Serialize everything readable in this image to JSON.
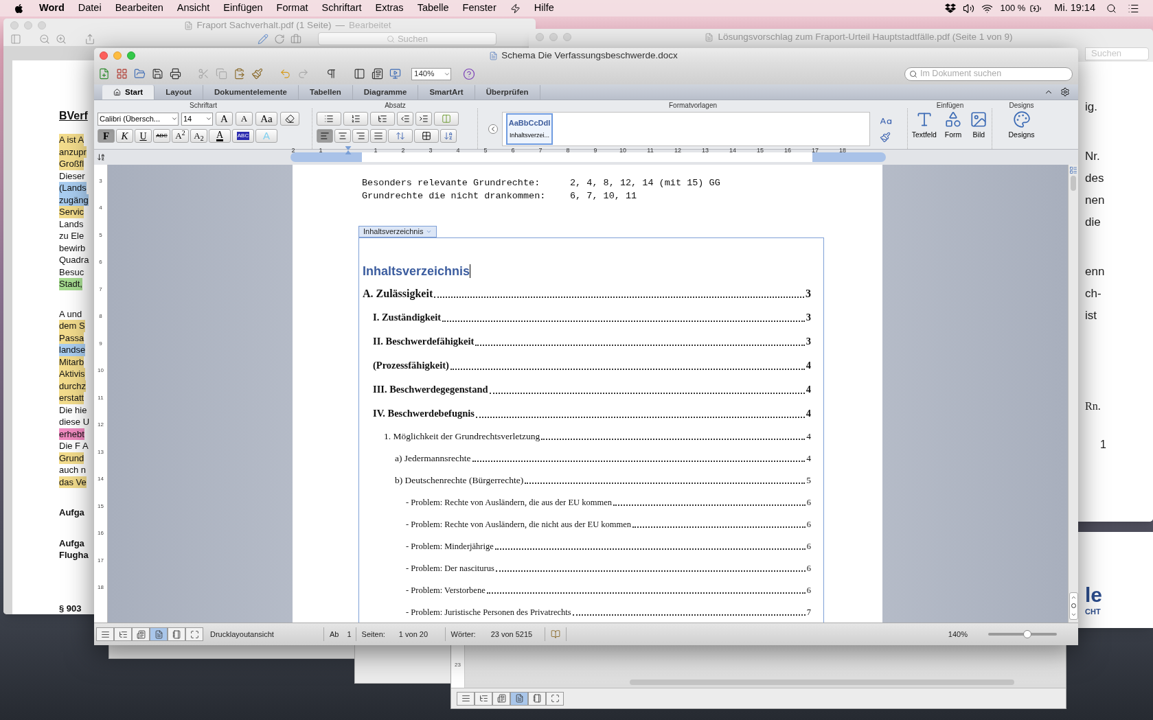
{
  "menubar": {
    "app": "Word",
    "items": [
      "Datei",
      "Bearbeiten",
      "Ansicht",
      "Einfügen",
      "Format",
      "Schriftart",
      "Extras",
      "Tabelle",
      "Fenster",
      "Hilfe"
    ],
    "battery": "100 %",
    "clock": "Mi. 19:14"
  },
  "left_window": {
    "title": "Fraport Sachverhalt.pdf (1 Seite)",
    "separator": "—",
    "status": "Bearbeitet",
    "search_placeholder": "Suchen",
    "heading": "BVerf",
    "paragraphs": [
      {
        "lines": [
          {
            "text": "A ist A",
            "color": "#f3dc8c"
          },
          {
            "text": "anzupr",
            "color": "#f3dc8c"
          },
          {
            "text": "Großfl",
            "color": "#f3dc8c"
          },
          {
            "text": "Dieser"
          },
          {
            "text": "(Lands",
            "color": "#a9cdf0"
          },
          {
            "text": "zugäng",
            "color": "#a9cdf0"
          },
          {
            "text": "Servic",
            "color": "#f3dc8c"
          },
          {
            "text": "Lands"
          },
          {
            "text": "zu Ele"
          },
          {
            "text": "bewirb"
          },
          {
            "text": "Quadra"
          },
          {
            "text": "Besuc"
          },
          {
            "text": "Stadt,",
            "color": "#a6dc90"
          }
        ]
      },
      {
        "lines": [
          {
            "text": "A und"
          },
          {
            "text": "dem S",
            "color": "#f3dc8c"
          },
          {
            "text": "Passa",
            "color": "#f3dc8c"
          },
          {
            "text": "landse",
            "color": "#a9cdf0"
          },
          {
            "text": "Mitarb",
            "color": "#f3dc8c"
          },
          {
            "text": "Aktivis",
            "color": "#f3dc8c"
          },
          {
            "text": "durchz",
            "color": "#f3dc8c"
          },
          {
            "text": "erstatt",
            "color": "#f3dc8c"
          },
          {
            "text": "Die hie"
          },
          {
            "text": "diese U"
          },
          {
            "text": "erhebt",
            "color": "#f08ac0"
          },
          {
            "text": "Die F A"
          },
          {
            "text": "Grund",
            "color": "#f3dc8c"
          },
          {
            "text": "auch n"
          },
          {
            "text": "das Ve",
            "color": "#f3dc8c"
          }
        ]
      }
    ],
    "bold_paragraphs": [
      [
        "Aufga"
      ],
      [
        "Aufga",
        "Flugha"
      ],
      [
        "§ 903"
      ]
    ]
  },
  "right_window": {
    "title": "Lösungsvorschlag zum Fraport-Urteil Hauptstadtfälle.pdf (Seite 1 von 9)",
    "search_placeholder": "Suchen",
    "paragraphs": [
      [
        "ig."
      ],
      [
        "Nr.",
        "des",
        "nen",
        "die"
      ],
      [
        "enn",
        "ch-",
        "ist"
      ]
    ],
    "footnote_label": "Rn.",
    "footnote_number": "1"
  },
  "lower_right_window": {
    "logo_text": "le",
    "logo_subtext": "CHT"
  },
  "bottom_window": {
    "ruler_mark": "23",
    "view_buttons": [
      {
        "kind": "draft",
        "selected": false
      },
      {
        "kind": "outline",
        "selected": false
      },
      {
        "kind": "publishing",
        "selected": false
      },
      {
        "kind": "print",
        "selected": true
      },
      {
        "kind": "notebook",
        "selected": false
      },
      {
        "kind": "fullscreen",
        "selected": false
      }
    ]
  },
  "word": {
    "title": "Schema Die Verfassungsbeschwerde.docx",
    "zoom": "140%",
    "search_placeholder": "Im Dokument suchen",
    "tabs": [
      {
        "label": "Start",
        "selected": true
      },
      {
        "label": "Layout",
        "selected": false
      },
      {
        "label": "Dokumentelemente",
        "selected": false
      },
      {
        "label": "Tabellen",
        "selected": false
      },
      {
        "label": "Diagramme",
        "selected": false
      },
      {
        "label": "SmartArt",
        "selected": false
      },
      {
        "label": "Überprüfen",
        "selected": false
      }
    ],
    "font_group": {
      "label": "Schriftart",
      "font": "Calibri (Übersch...",
      "size": "14",
      "row1_buttons": [
        {
          "label": "A",
          "kind": "grow"
        },
        {
          "label": "A",
          "kind": "shrink"
        },
        {
          "label": "Aa",
          "kind": "case"
        }
      ],
      "row2_buttons": [
        {
          "label": "F",
          "kind": "bold",
          "selected": true
        },
        {
          "label": "K",
          "kind": "italic",
          "selected": false
        },
        {
          "label": "U",
          "kind": "underline",
          "selected": false
        },
        {
          "label": "ABC",
          "kind": "strike",
          "selected": false
        },
        {
          "label": "A$^{2}$",
          "kind": "script",
          "selected": false
        },
        {
          "label": "A$_{2}$",
          "kind": "script",
          "selected": false
        },
        {
          "label": "A",
          "kind": "font-color",
          "selected": false
        },
        {
          "label": "ABC",
          "kind": "highlight",
          "selected": false
        },
        {
          "label": "A",
          "kind": "effect",
          "selected": false
        }
      ]
    },
    "paragraph_group": {
      "label": "Absatz",
      "alignments": [
        {
          "kind": "left",
          "selected": true
        },
        {
          "kind": "center",
          "selected": false
        },
        {
          "kind": "right",
          "selected": false
        },
        {
          "kind": "justify",
          "selected": false
        }
      ]
    },
    "styles_group": {
      "label": "Formatvorlagen",
      "sample": "AaBbCcDdI",
      "name": "Inhaltsverzei...",
      "selected": true
    },
    "insert_group": {
      "label": "Einfügen",
      "items": [
        {
          "label": "Textfeld",
          "kind": "textbox"
        },
        {
          "label": "Form",
          "kind": "shape"
        },
        {
          "label": "Bild",
          "kind": "picture"
        }
      ]
    },
    "designs_group": {
      "label": "Designs",
      "item": "Designs"
    },
    "ruler": [
      "2",
      "1",
      "1",
      "2",
      "3",
      "4",
      "5",
      "6",
      "7",
      "8",
      "9",
      "10",
      "11",
      "12",
      "13",
      "14",
      "15",
      "16",
      "17",
      "18"
    ],
    "vertical_ruler": [
      "3",
      "4",
      "5",
      "6",
      "7",
      "8",
      "9",
      "10",
      "11",
      "12",
      "13",
      "14",
      "15",
      "16",
      "17",
      "18"
    ],
    "document": {
      "intro": [
        {
          "label": "Besonders relevante Grundrechte:",
          "value": "2, 4, 8, 12, 14 (mit 15) GG"
        },
        {
          "label": "Grundrechte die nicht drankommen:",
          "value": "6, 7, 10, 11"
        }
      ],
      "toc_tag": "Inhaltsverzeichnis",
      "toc_heading": "Inhaltsverzeichnis",
      "toc": [
        {
          "title": "A. Zulässigkeit",
          "page": "3",
          "children": [
            {
              "title": "I. Zuständigkeit",
              "page": "3"
            },
            {
              "title": "II. Beschwerdefähigkeit",
              "page": "3"
            },
            {
              "title": "(Prozessfähigkeit)",
              "page": "4"
            },
            {
              "title": "III. Beschwerdegegenstand",
              "page": "4"
            },
            {
              "title": "IV. Beschwerdebefugnis",
              "page": "4",
              "children": [
                {
                  "title": "1. Möglichkeit der Grundrechtsverletzung",
                  "page": "4",
                  "children": [
                    {
                      "title": "a) Jedermannsrechte",
                      "page": "4"
                    },
                    {
                      "title": "b) Deutschenrechte (Bürgerrechte)",
                      "page": "5",
                      "children": [
                        {
                          "title": "- Problem: Rechte von Ausländern, die aus der EU kommen",
                          "page": "6"
                        },
                        {
                          "title": "- Problem: Rechte von Ausländern, die nicht aus der EU kommen",
                          "page": "6"
                        },
                        {
                          "title": "- Problem: Minderjährige",
                          "page": "6"
                        },
                        {
                          "title": "- Problem: Der nasciturus",
                          "page": "6"
                        },
                        {
                          "title": "- Problem: Verstorbene",
                          "page": "6"
                        },
                        {
                          "title": "- Problem: Juristische Personen des Privatrechts",
                          "page": "7"
                        }
                      ]
                    }
                  ]
                }
              ]
            }
          ]
        }
      ]
    },
    "status": {
      "view_buttons": [
        {
          "kind": "draft",
          "selected": false
        },
        {
          "kind": "outline",
          "selected": false
        },
        {
          "kind": "publishing",
          "selected": false
        },
        {
          "kind": "print",
          "selected": true
        },
        {
          "kind": "notebook",
          "selected": false
        },
        {
          "kind": "fullscreen",
          "selected": false
        }
      ],
      "view_name": "Drucklayoutansicht",
      "section_label": "Ab",
      "section": "1",
      "pages_label": "Seiten:",
      "pages": "1 von 20",
      "words_label": "Wörter:",
      "words": "23 von 5215",
      "zoom": "140%",
      "zoom_slider": {
        "level": 0.57
      }
    }
  }
}
